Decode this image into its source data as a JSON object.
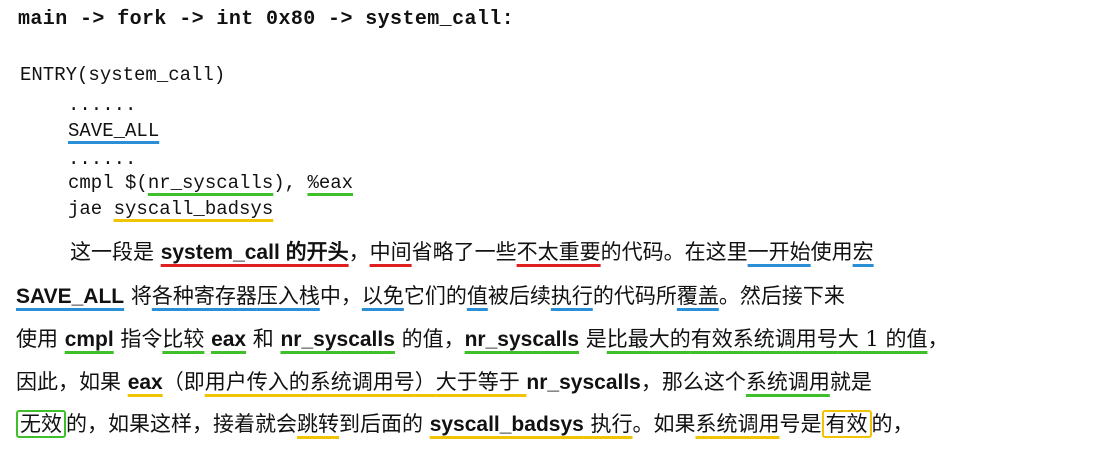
{
  "heading": "main -> fork -> int 0x80 -> system_call:",
  "code": {
    "entry": "ENTRY(system_call)",
    "ellipsis1": "......",
    "save_all": "SAVE_ALL",
    "ellipsis2": "......",
    "cmpl_prefix": "cmpl $(",
    "nr_syscalls": "nr_syscalls",
    "cmpl_mid": "), ",
    "eax": "%eax",
    "jae_prefix": "jae ",
    "syscall_badsys": "syscall_badsys"
  },
  "paragraph": {
    "l1": [
      "这一段是 ",
      "system_call 的开头",
      "，",
      "中间",
      "省略了一些",
      "不太重要",
      "的代码。在这里",
      "一开始",
      "使用",
      "宏"
    ],
    "l2": [
      "SAVE_ALL",
      " 将",
      "各种寄存器",
      "压入栈",
      "中，",
      "以免",
      "它们的",
      "值",
      "被后续",
      "执行",
      "的代码所",
      "覆盖",
      "。然后接下来"
    ],
    "l3": [
      "使用 ",
      "cmpl",
      " 指令",
      "比较",
      " ",
      "eax",
      " 和 ",
      "nr_syscalls",
      " 的值，",
      "nr_syscalls",
      " 是",
      "比最大的",
      "有效系统调用号",
      "大 1 的值",
      "，"
    ],
    "l4": [
      "因此，如果 ",
      "eax",
      "（即",
      "用户传入的",
      "系统调用号",
      "）",
      "大于等于 ",
      "nr_syscalls",
      "，那么这个",
      "系统调用",
      "就是"
    ],
    "l5": [
      "无效",
      "的，如果这样，接着就会",
      "跳转",
      "到后面的 ",
      "syscall_badsys",
      " 执行",
      "。如果",
      "系统调用",
      "号是",
      "有效",
      "的，"
    ]
  }
}
